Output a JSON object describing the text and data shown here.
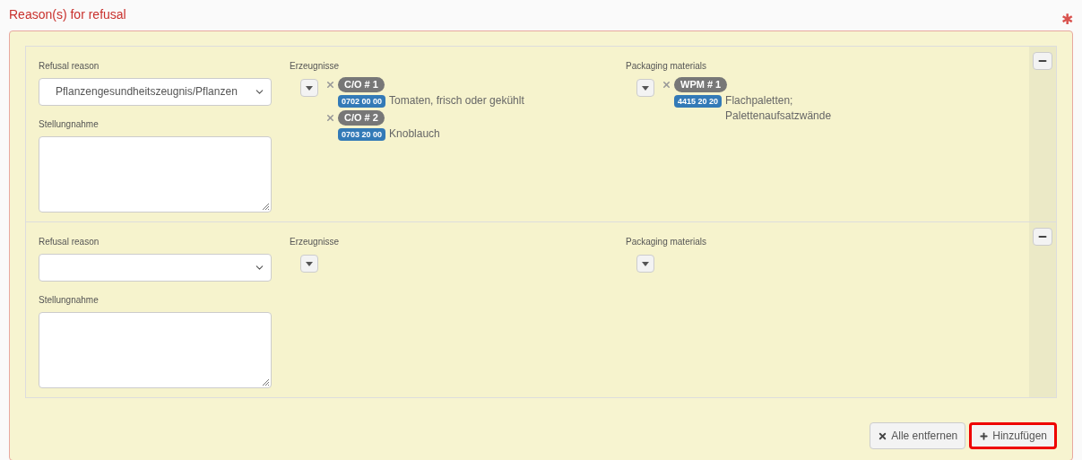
{
  "section": {
    "title": "Reason(s) for refusal",
    "required_mark": "✱"
  },
  "reasons": [
    {
      "refusal_reason": {
        "label": "Refusal reason",
        "value": "Pflanzengesundheitszeugnis/Pflanzen"
      },
      "statement": {
        "label": "Stellungnahme"
      },
      "products": {
        "label": "Erzeugnisse",
        "items": [
          {
            "tag": "C/O # 1",
            "code": "0702 00 00",
            "name": "Tomaten, frisch oder gekühlt"
          },
          {
            "tag": "C/O # 2",
            "code": "0703 20 00",
            "name": "Knoblauch"
          }
        ]
      },
      "packaging": {
        "label": "Packaging materials",
        "items": [
          {
            "tag": "WPM # 1",
            "code": "4415 20 20",
            "name": "Flachpaletten; Palettenaufsatzwände"
          }
        ]
      }
    },
    {
      "refusal_reason": {
        "label": "Refusal reason"
      },
      "statement": {
        "label": "Stellungnahme"
      },
      "products": {
        "label": "Erzeugnisse"
      },
      "packaging": {
        "label": "Packaging materials"
      }
    }
  ],
  "buttons": [
    {
      "label": "Alle entfernen",
      "kind": "remove_all",
      "highlighted": false
    },
    {
      "label": "Hinzufügen",
      "kind": "add",
      "highlighted": true
    }
  ]
}
